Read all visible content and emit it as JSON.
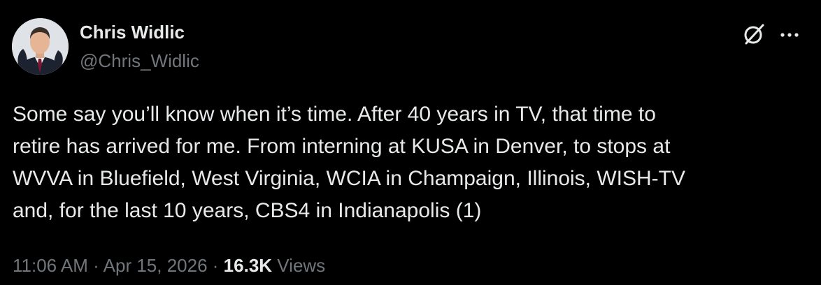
{
  "author": {
    "display_name": "Chris Widlic",
    "handle": "@Chris_Widlic"
  },
  "icons": {
    "avatar": "profile-photo",
    "grok": "grok-icon",
    "more": "more-options-icon"
  },
  "tweet": {
    "lines": [
      "Some say you’ll know when it’s time. After 40 years in TV, that time to",
      "retire has arrived for me. From interning at KUSA in Denver, to stops at",
      "WVVA in Bluefield, West Virginia, WCIA in Champaign, Illinois, WISH-TV",
      "and, for the last 10 years, CBS4 in Indianapolis (1)"
    ]
  },
  "meta": {
    "time": "11:06 AM",
    "separator": "·",
    "date": "Apr 15, 2026",
    "views_count": "16.3K",
    "views_label": "Views"
  },
  "colors": {
    "background": "#000000",
    "primary_text": "#e7e9ea",
    "secondary_text": "#71767b"
  }
}
